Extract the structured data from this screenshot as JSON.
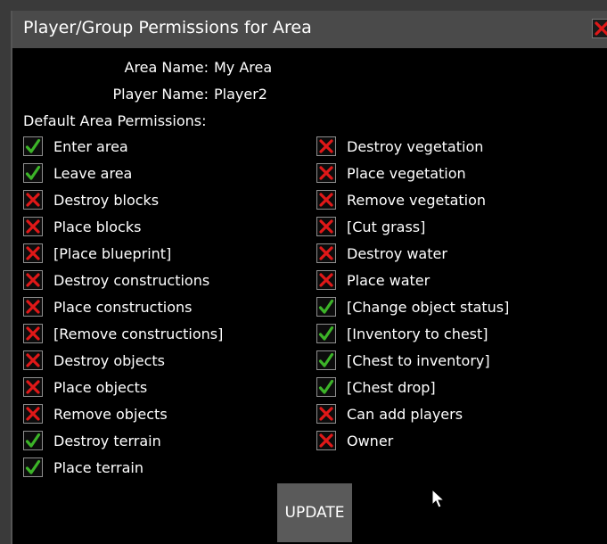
{
  "window": {
    "title": "Player/Group Permissions for Area",
    "close_icon": "close-x-icon",
    "accent_colors": {
      "allowed": "#3cb428",
      "denied": "#e01818"
    }
  },
  "info": {
    "area_name_label": "Area Name:",
    "area_name_value": "My Area",
    "player_name_label": "Player Name:",
    "player_name_value": "Player2"
  },
  "permissions": {
    "section_label": "Default Area Permissions:",
    "left": [
      {
        "label": "Enter area",
        "allowed": true
      },
      {
        "label": "Leave area",
        "allowed": true
      },
      {
        "label": "Destroy blocks",
        "allowed": false
      },
      {
        "label": "Place blocks",
        "allowed": false
      },
      {
        "label": "[Place blueprint]",
        "allowed": false
      },
      {
        "label": "Destroy constructions",
        "allowed": false
      },
      {
        "label": "Place constructions",
        "allowed": false
      },
      {
        "label": "[Remove constructions]",
        "allowed": false
      },
      {
        "label": "Destroy objects",
        "allowed": false
      },
      {
        "label": "Place objects",
        "allowed": false
      },
      {
        "label": "Remove objects",
        "allowed": false
      },
      {
        "label": "Destroy terrain",
        "allowed": true
      },
      {
        "label": "Place terrain",
        "allowed": true
      }
    ],
    "right": [
      {
        "label": "Destroy vegetation",
        "allowed": false
      },
      {
        "label": "Place vegetation",
        "allowed": false
      },
      {
        "label": "Remove vegetation",
        "allowed": false
      },
      {
        "label": "[Cut grass]",
        "allowed": false
      },
      {
        "label": "Destroy water",
        "allowed": false
      },
      {
        "label": "Place water",
        "allowed": false
      },
      {
        "label": "[Change object status]",
        "allowed": true
      },
      {
        "label": "[Inventory to chest]",
        "allowed": true
      },
      {
        "label": "[Chest to inventory]",
        "allowed": true
      },
      {
        "label": "[Chest drop]",
        "allowed": true
      },
      {
        "label": "Can add players",
        "allowed": false
      },
      {
        "label": "Owner",
        "allowed": false
      }
    ]
  },
  "footer": {
    "update_label": "UPDATE"
  }
}
